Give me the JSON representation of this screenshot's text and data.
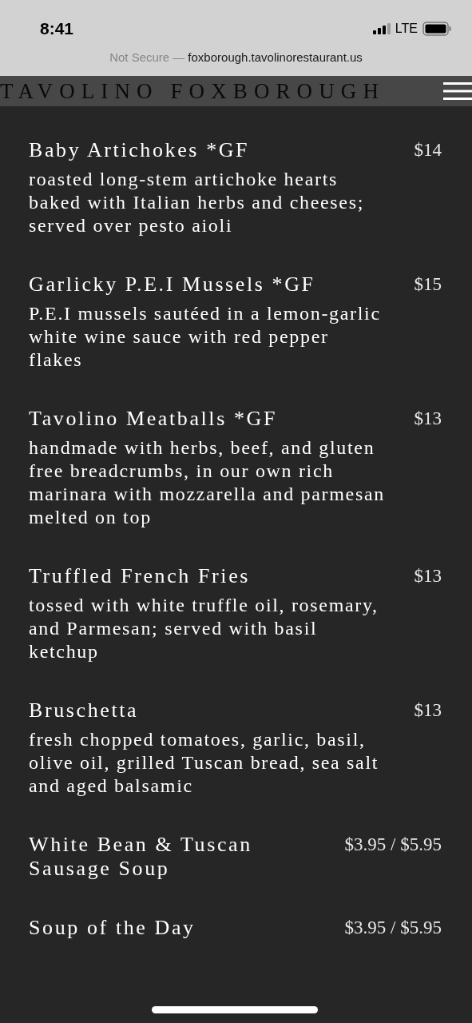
{
  "status_bar": {
    "time": "8:41",
    "network": "LTE"
  },
  "address_bar": {
    "security": "Not Secure —",
    "url": "foxborough.tavolinorestaurant.us"
  },
  "header": {
    "title": "TAVOLINO FOXBOROUGH"
  },
  "menu_items": [
    {
      "name": "Baby Artichokes *GF",
      "price": "$14",
      "description": "roasted long-stem artichoke hearts baked with Italian herbs and cheeses; served over pesto aioli"
    },
    {
      "name": "Garlicky P.E.I Mussels *GF",
      "price": "$15",
      "description": "P.E.I mussels sautéed in a lemon-garlic white wine sauce with red pepper flakes"
    },
    {
      "name": "Tavolino Meatballs *GF",
      "price": "$13",
      "description": "handmade with herbs, beef, and gluten free breadcrumbs, in our own rich marinara with mozzarella and parmesan melted on top"
    },
    {
      "name": "Truffled French Fries",
      "price": "$13",
      "description": "tossed with white truffle oil, rosemary, and Parmesan; served with basil ketchup"
    },
    {
      "name": "Bruschetta",
      "price": "$13",
      "description": "fresh chopped tomatoes, garlic, basil, olive oil, grilled Tuscan bread, sea salt and aged balsamic"
    },
    {
      "name": "White Bean & Tuscan Sausage Soup",
      "price": "$3.95 / $5.95"
    },
    {
      "name": "Soup of the Day",
      "price": "$3.95 / $5.95"
    }
  ]
}
